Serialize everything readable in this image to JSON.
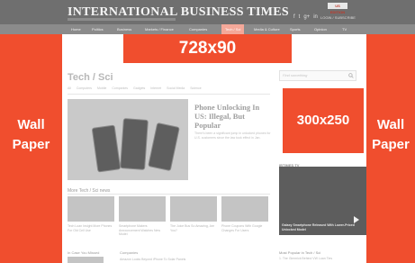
{
  "header": {
    "logo": "INTERNATIONAL BUSINESS TIMES",
    "edition_label": "US EDITION",
    "edition_value": "US EDITION",
    "social": [
      "f",
      "t",
      "g+",
      "in"
    ],
    "account": "LOGIN / SUBSCRIBE"
  },
  "nav": {
    "items": [
      "Home",
      "Politics",
      "Business",
      "Markets / Finance",
      "Companies",
      "Tech / Sci",
      "Media & Culture",
      "Sports",
      "Opinion",
      "TV"
    ],
    "active": "Tech / Sci"
  },
  "ads": {
    "banner": "728x90",
    "wallpaper_line1": "Wall",
    "wallpaper_line2": "Paper",
    "rectangle": "300x250"
  },
  "main": {
    "section_title": "Tech / Sci",
    "subnav": [
      "All",
      "Computers",
      "Mobile",
      "Companies",
      "Gadgets",
      "Internet",
      "Social Media",
      "Science"
    ],
    "hero_headline": "Phone Unlocking In US: Illegal, But Popular",
    "hero_summary": "There's been a significant jump in unlocked phones for U.S. customers since the law took effect in Jan.",
    "more_label": "More Tech / Sci news",
    "thumb_captions": [
      "Tech Loan Insight More Phones For Old Cell Use",
      "Smartphone Makers Announcement Watches New Model",
      "The Juice Bus So Amazing, Are You?",
      "Phone Coupons With Google Changes For Users"
    ],
    "bottom_left": "In Case You Missed",
    "bottom_right": "Companies",
    "bottom_item": "Amazon Looks Beyond iPhone To Solar Panels"
  },
  "sidebar": {
    "search_placeholder": "Find something",
    "ibtimes_tv": "IBTIMES TV",
    "video_caption": "Galaxy Smartphone Released With Lower-Priced Unlocked Model",
    "most_popular": "Most Popular in Tech / Sci",
    "popular_item": "1. The Gimmick Behind VW Loan Ties"
  },
  "colors": {
    "ad_fill": "#f04e2e",
    "header": "#6f6f6f",
    "nav": "#8b8b8b",
    "nav_active": "#f4a899"
  }
}
